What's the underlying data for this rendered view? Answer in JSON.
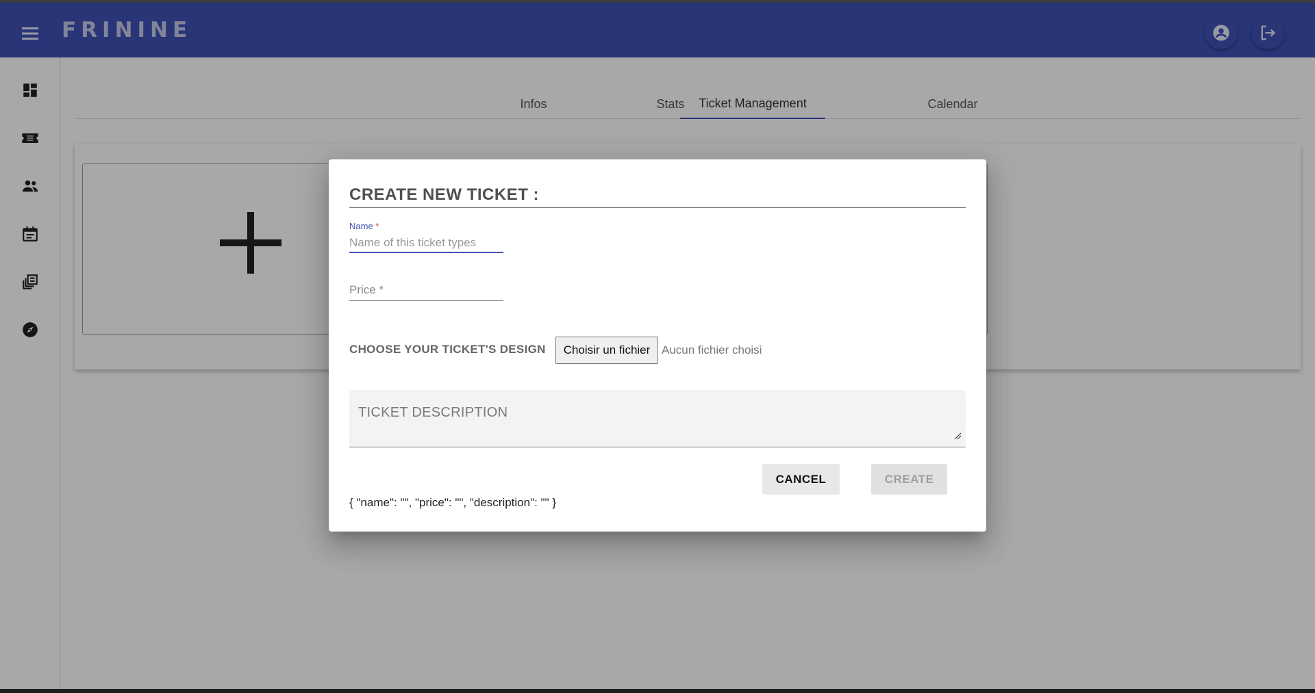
{
  "appbar": {
    "brand": "FRININE",
    "color": "#3f51b5",
    "icons": [
      "menu-icon",
      "account-icon",
      "logout-icon"
    ]
  },
  "sidebar": {
    "items": [
      {
        "icon": "dashboard-icon"
      },
      {
        "icon": "ticket-icon"
      },
      {
        "icon": "people-icon"
      },
      {
        "icon": "calendar-icon"
      },
      {
        "icon": "library-icon"
      },
      {
        "icon": "explore-icon"
      }
    ]
  },
  "tabs": [
    {
      "label": "Infos",
      "active": false
    },
    {
      "label": "Stats",
      "active": false
    },
    {
      "label": "Ticket Management",
      "active": true
    },
    {
      "label": "Calendar",
      "active": false
    }
  ],
  "dialog": {
    "title": "CREATE NEW TICKET :",
    "name_label": "Name",
    "required_mark": "*",
    "name_placeholder": "Name of this ticket types",
    "name_value": "",
    "price_placeholder": "Price *",
    "design_label": "CHOOSE YOUR TICKET'S DESIGN",
    "file_button": "Choisir un fichier",
    "file_status": "Aucun fichier choisi",
    "description_placeholder": "TICKET DESCRIPTION",
    "cancel_label": "CANCEL",
    "create_label": "CREATE",
    "debug_output": "{ \"name\": \"\", \"price\": \"\", \"description\": \"\" }"
  }
}
